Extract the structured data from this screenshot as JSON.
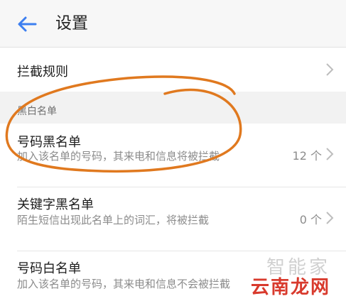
{
  "header": {
    "title": "设置",
    "back_icon": "arrow-left-icon"
  },
  "rules": {
    "label": "拦截规则"
  },
  "section": {
    "title": "黑白名单"
  },
  "items": [
    {
      "title": "号码黑名单",
      "desc": "加入该名单的号码，其来电和信息将被拦截",
      "count": "12 个"
    },
    {
      "title": "关键字黑名单",
      "desc": "陌生短信出现此名单上的词汇，将被拦截",
      "count": "0 个"
    },
    {
      "title": "号码白名单",
      "desc": "加入该名单的号码，其来电和信息不会被拦截",
      "count": ""
    }
  ],
  "watermark": {
    "line1": "智能家",
    "line2": "云南龙网"
  },
  "colors": {
    "accent": "#3d7ff0",
    "annotation": "#e0791f",
    "watermark_red": "#d83a2d"
  }
}
